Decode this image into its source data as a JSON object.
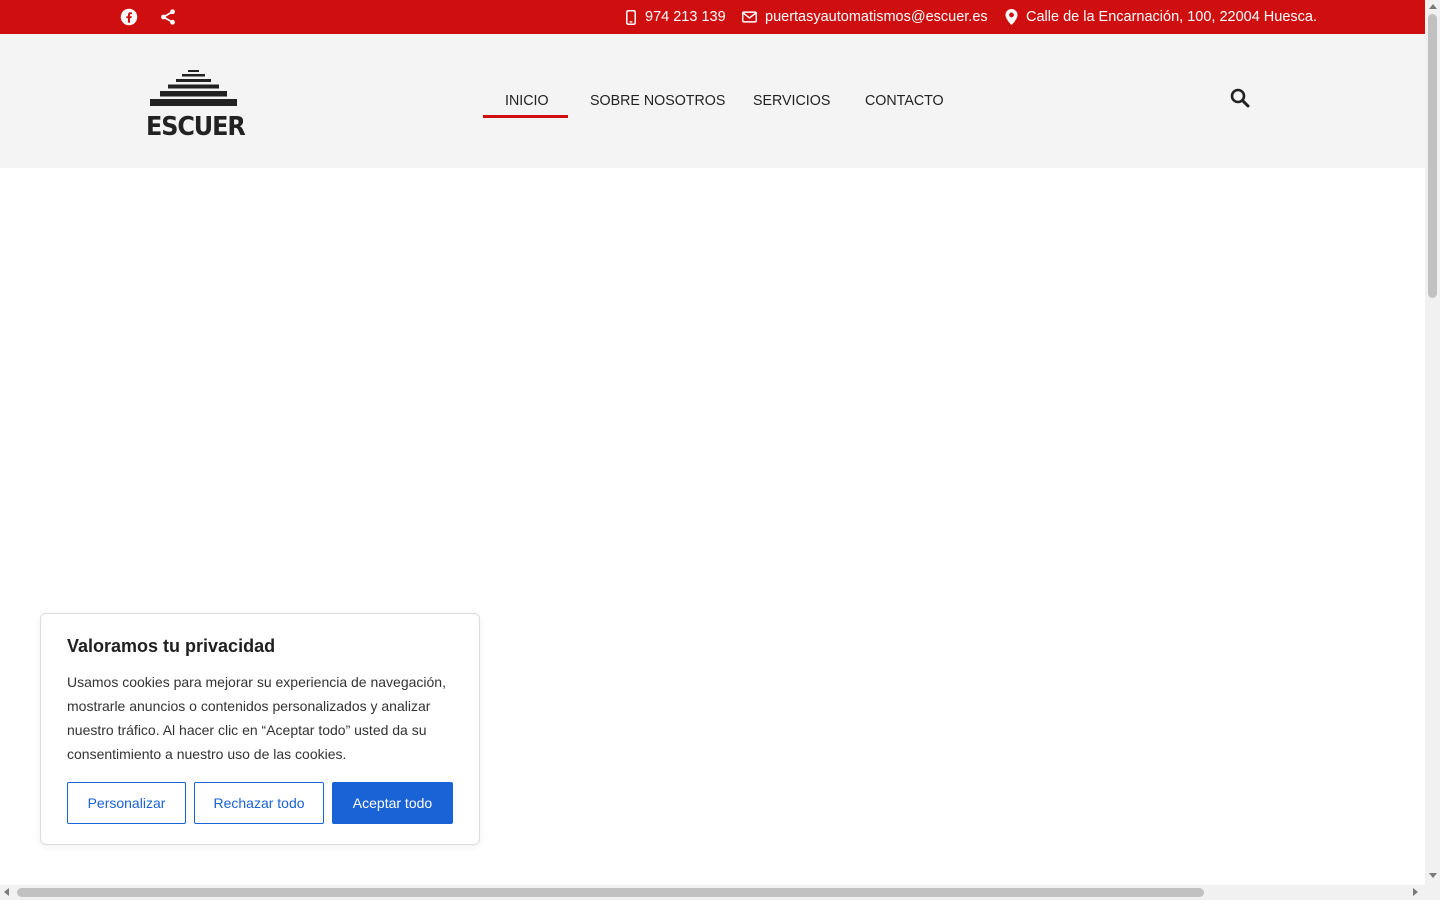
{
  "topbar": {
    "background": "#cf0f0f",
    "social": [
      {
        "icon": "facebook-icon"
      },
      {
        "icon": "share-icon"
      }
    ],
    "phone": {
      "icon": "mobile-phone-icon",
      "text": "974 213 139"
    },
    "email": {
      "icon": "envelope-icon",
      "text": "puertasyautomatismos@escuer.es"
    },
    "address": {
      "icon": "map-pin-icon",
      "text": "Calle de la Encarnación, 100, 22004 Huesca."
    }
  },
  "header": {
    "logo_text": "ESCUER",
    "nav": [
      {
        "label": "INICIO",
        "active": true
      },
      {
        "label": "SOBRE NOSOTROS"
      },
      {
        "label": "SERVICIOS"
      },
      {
        "label": "CONTACTO"
      }
    ],
    "search_icon": "search-icon",
    "accent": "#cf0f0f"
  },
  "cookie_banner": {
    "title": "Valoramos tu privacidad",
    "text": "Usamos cookies para mejorar su experiencia de navegación, mostrarle anuncios o contenidos personalizados y analizar nuestro tráfico. Al hacer clic en “Aceptar todo” usted da su consentimiento a nuestro uso de las cookies.",
    "buttons": {
      "customize": "Personalizar",
      "reject": "Rechazar todo",
      "accept": "Aceptar todo"
    },
    "accent": "#1a63d6"
  }
}
